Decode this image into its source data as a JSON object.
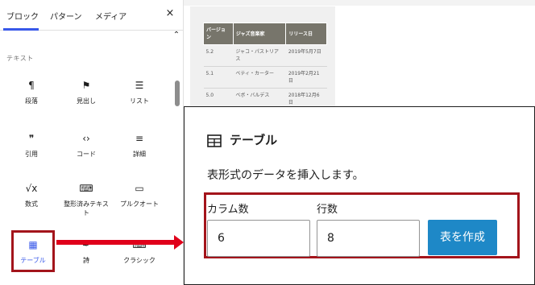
{
  "inserter": {
    "tabs": [
      "ブロック",
      "パターン",
      "メディア"
    ],
    "active_tab": "ブロック",
    "close_glyph": "×",
    "collapse_glyph": "⌃",
    "section_title": "テキスト",
    "blocks": [
      {
        "label": "段落",
        "icon": "paragraph-icon",
        "glyph": "¶"
      },
      {
        "label": "見出し",
        "icon": "bookmark-icon",
        "glyph": "⚑"
      },
      {
        "label": "リスト",
        "icon": "list-icon",
        "glyph": "☰"
      },
      {
        "label": "引用",
        "icon": "quote-icon",
        "glyph": "❞"
      },
      {
        "label": "コード",
        "icon": "code-icon",
        "glyph": "‹›"
      },
      {
        "label": "詳細",
        "icon": "details-icon",
        "glyph": "≡"
      },
      {
        "label": "数式",
        "icon": "math-icon",
        "glyph": "√x"
      },
      {
        "label": "整形済みテキスト",
        "icon": "preformatted-icon",
        "glyph": "⌨"
      },
      {
        "label": "プルクオート",
        "icon": "pullquote-icon",
        "glyph": "▭"
      },
      {
        "label": "テーブル",
        "icon": "table-icon",
        "glyph": "▦"
      },
      {
        "label": "詩",
        "icon": "verse-icon",
        "glyph": "✒"
      },
      {
        "label": "クラシック",
        "icon": "classic-icon",
        "glyph": "⌨"
      }
    ]
  },
  "preview_table": {
    "headers": [
      "バージョン",
      "ジャズ音楽家",
      "リリース日"
    ],
    "rows": [
      [
        "5.2",
        "ジャコ・パストリアス",
        "2019年5月7日"
      ],
      [
        "5.1",
        "ベティ・カーター",
        "2019年2月21日"
      ],
      [
        "5.0",
        "ベボ・バルデス",
        "2018年12月6日"
      ]
    ]
  },
  "table_panel": {
    "title": "テーブル",
    "description": "表形式のデータを挿入します。",
    "columns_label": "カラム数",
    "columns_value": "6",
    "rows_label": "行数",
    "rows_value": "8",
    "create_button": "表を作成"
  },
  "colors": {
    "accent": "#3858e9",
    "button": "#1e88c7",
    "highlight": "#a3141b",
    "arrow": "#e0001a"
  }
}
